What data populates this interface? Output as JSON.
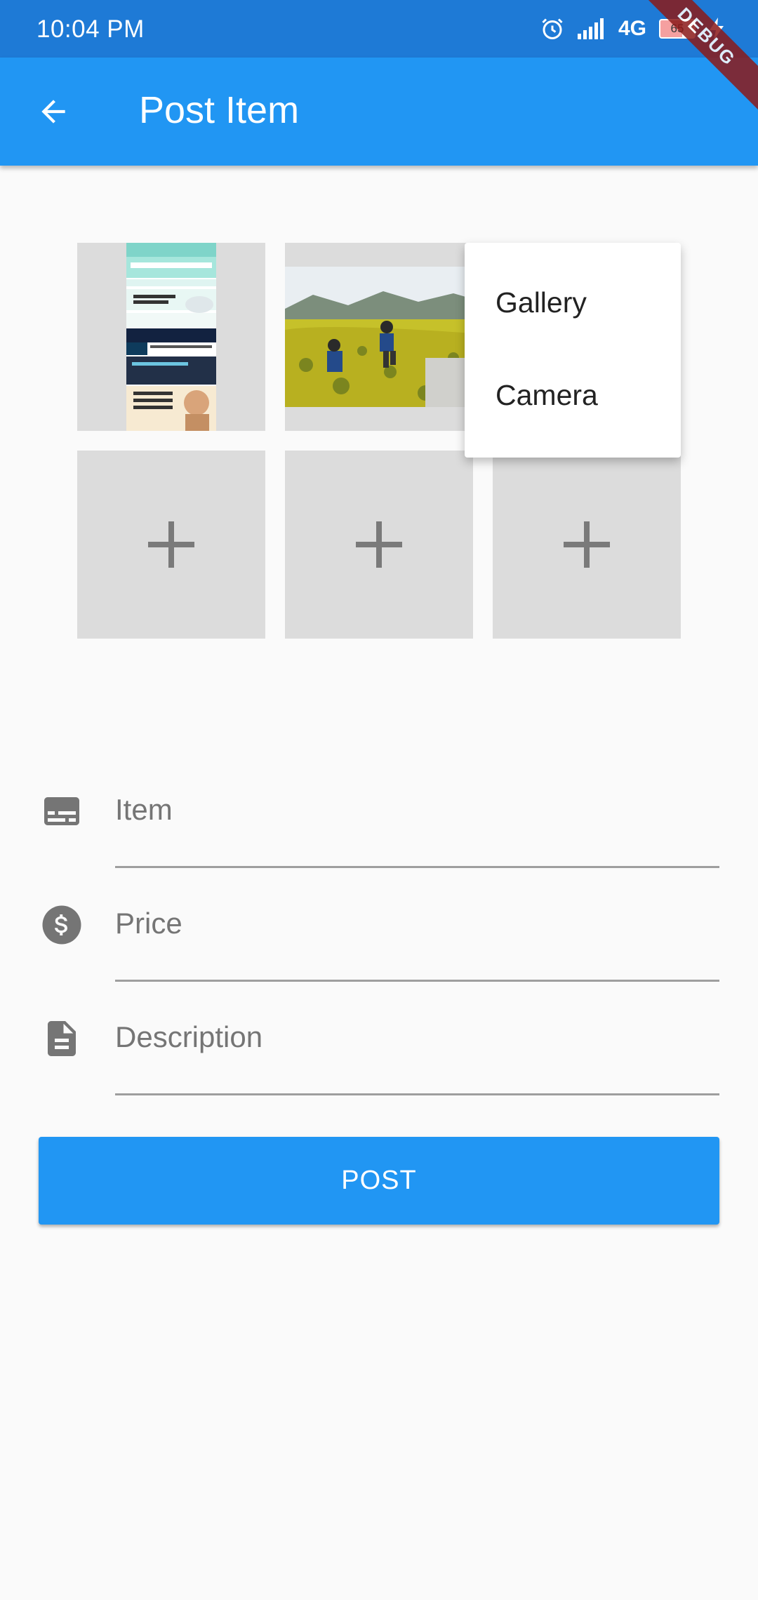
{
  "status_bar": {
    "time": "10:04 PM",
    "network": "4G",
    "battery": "65"
  },
  "app_bar": {
    "title": "Post Item",
    "back_icon": "arrow-back-icon",
    "debug_banner": "DEBUG",
    "color": "#2196f3"
  },
  "photos": {
    "add_icon": "add-icon",
    "thumbnails": [
      "amazon-app-screenshot",
      "flower-field-photo"
    ]
  },
  "image_source_menu": {
    "items": [
      "Gallery",
      "Camera"
    ]
  },
  "form": {
    "item": {
      "placeholder": "Item",
      "icon": "subtitles-icon"
    },
    "price": {
      "placeholder": "Price",
      "icon": "dollar-icon"
    },
    "description": {
      "placeholder": "Description",
      "icon": "document-icon"
    }
  },
  "post_button": {
    "label": "POST"
  }
}
